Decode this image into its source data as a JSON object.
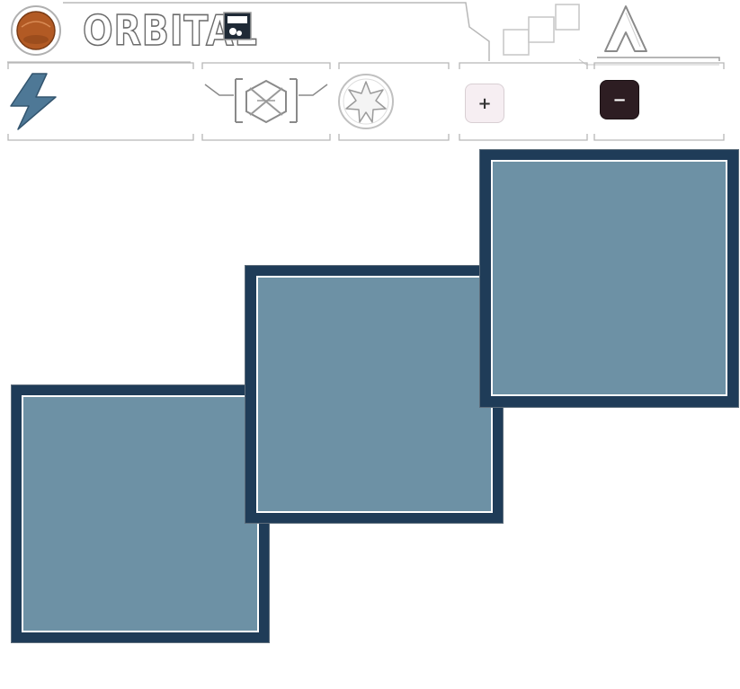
{
  "header": {
    "title": "ORBITAL"
  },
  "toolbar": {
    "zoom_in_label": "+",
    "zoom_out_label": "−"
  },
  "board": {
    "tiles": [
      {
        "name": "tile-left"
      },
      {
        "name": "tile-middle"
      },
      {
        "name": "tile-right"
      }
    ]
  },
  "colors": {
    "tile_fill": "#6d91a5",
    "tile_border": "#1f3c58",
    "tile_inner_line": "#ffffff",
    "logo_orange": "#b25a24",
    "zoom_in_bg": "#f6eef2",
    "zoom_out_bg": "#2d1d22",
    "lightning_blue": "#4e7896",
    "outline_gray": "#9a9a9a"
  },
  "icons": {
    "logo": "orb-logo-icon",
    "flag": "flag-icon",
    "steps": "stairs-icon",
    "arrow": "triangle-arrow-icon",
    "lightning": "lightning-icon",
    "hex": "hexagon-rune-icon",
    "star": "star-badge-icon"
  }
}
